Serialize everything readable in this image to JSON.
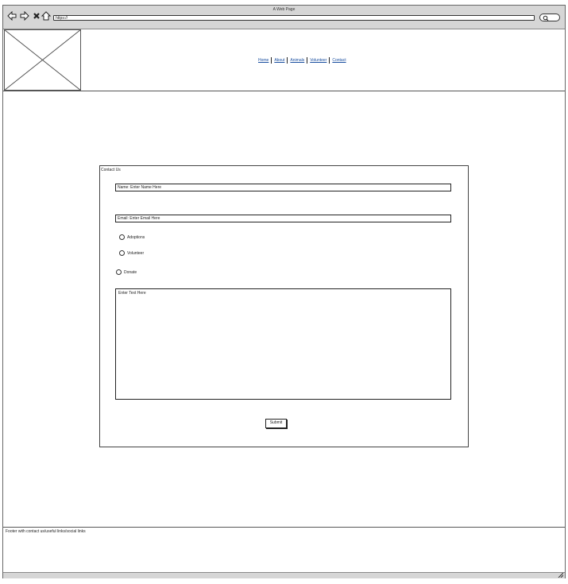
{
  "window": {
    "title": "A Web Page"
  },
  "toolbar": {
    "url": "https://"
  },
  "nav": {
    "items": [
      "Home",
      "About",
      "Animals",
      "Volunteer",
      "Contact"
    ]
  },
  "form": {
    "title": "Contact Us",
    "name_field": "Name: Enter Name Here",
    "email_field": "Email: Enter Email Here",
    "options": [
      "Adoptions",
      "Volunteer",
      "Donate"
    ],
    "message": "Enter Text Here",
    "submit_label": "Submit"
  },
  "footer": {
    "text": "Footer with contact us/useful links/social links"
  },
  "icons": [
    "back-arrow-icon",
    "forward-arrow-icon",
    "close-icon",
    "home-icon",
    "search-icon",
    "placeholder-image-icon"
  ]
}
